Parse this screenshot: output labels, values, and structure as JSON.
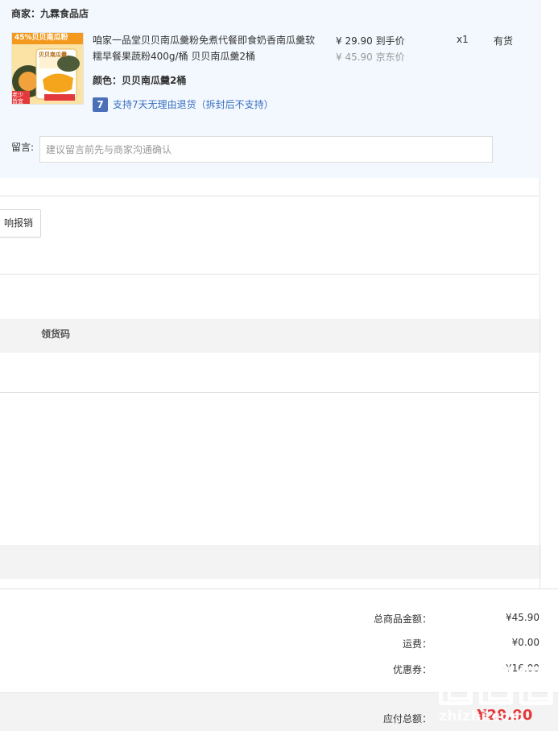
{
  "shop": {
    "header": "商家：九霖食品店"
  },
  "product": {
    "image_alt": "pumpkin-powder-product-image",
    "image_texts": [
      "45%贝贝南瓜粉",
      "贝贝南瓜羹",
      "老少皆宜"
    ],
    "name": "咱家一品堂贝贝南瓜羹粉免煮代餐即食奶香南瓜羹软糯早餐果蔬粉400g/桶 贝贝南瓜羹2桶",
    "color_label": "颜色：贝贝南瓜羹2桶",
    "return_badge": "7",
    "return_text": "支持7天无理由退货（拆封后不支持）",
    "price_now": "¥ 29.90 到手价",
    "price_old": "¥ 45.90 京东价",
    "quantity": "x1",
    "stock": "有货"
  },
  "remark": {
    "label": "留言:",
    "placeholder": "建议留言前先与商家沟通确认"
  },
  "invoice": {
    "button_label": "响报销"
  },
  "pickup_table": {
    "column_header": "领货码"
  },
  "summary": {
    "rows": [
      {
        "label": "总商品金额：",
        "value": "¥45.90"
      },
      {
        "label": "运费：",
        "value": "¥0.00"
      },
      {
        "label": "优惠券：",
        "value": "-¥16.00"
      }
    ],
    "pay_label": "应付总额：",
    "pay_value": "¥29.90"
  },
  "watermark": {
    "text": "zhizhi.com"
  },
  "colors": {
    "shop_bg": "#f3f8fe",
    "link_blue": "#3a6fc1",
    "badge_blue": "#4b70b9",
    "price_red": "#e4393c",
    "grey_bar": "#f3f3f3"
  }
}
